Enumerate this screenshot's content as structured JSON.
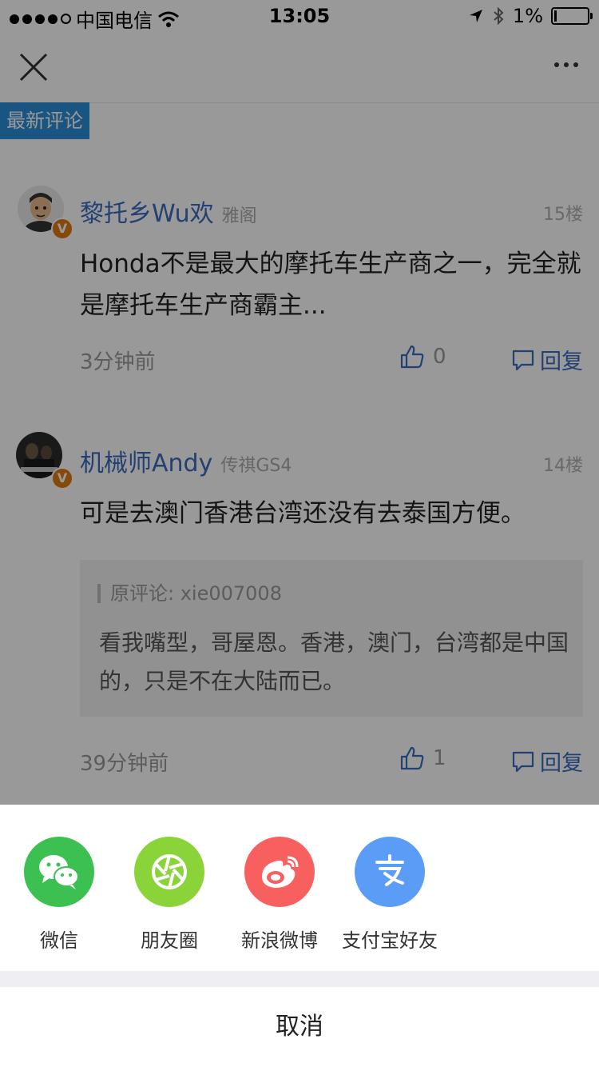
{
  "status_bar": {
    "carrier": "中国电信",
    "time": "13:05",
    "battery": "1%"
  },
  "section_tag": "最新评论",
  "comments": [
    {
      "username": "黎托乡Wu欢",
      "subtitle": "雅阁",
      "floor": "15楼",
      "content": "Honda不是最大的摩托车生产商之一，完全就是摩托车生产商霸主...",
      "time": "3分钟前",
      "likes": "0",
      "reply_label": "回复",
      "badge": "V"
    },
    {
      "username": "机械师Andy",
      "subtitle": "传祺GS4",
      "floor": "14楼",
      "content": "可是去澳门香港台湾还没有去泰国方便。",
      "quote_source": "原评论: xie007008",
      "quote_text": "看我嘴型，哥屋恩。香港，澳门，台湾都是中国的，只是不在大陆而已。",
      "time": "39分钟前",
      "likes": "1",
      "reply_label": "回复",
      "badge": "V"
    }
  ],
  "share_sheet": {
    "items": [
      {
        "label": "微信",
        "icon": "wechat-icon",
        "color": "#3cc051"
      },
      {
        "label": "朋友圈",
        "icon": "moments-icon",
        "color": "#8ad43a"
      },
      {
        "label": "新浪微博",
        "icon": "weibo-icon",
        "color": "#f8605f"
      },
      {
        "label": "支付宝好友",
        "icon": "alipay-icon",
        "color": "#5b9df6"
      }
    ],
    "cancel_label": "取消"
  }
}
